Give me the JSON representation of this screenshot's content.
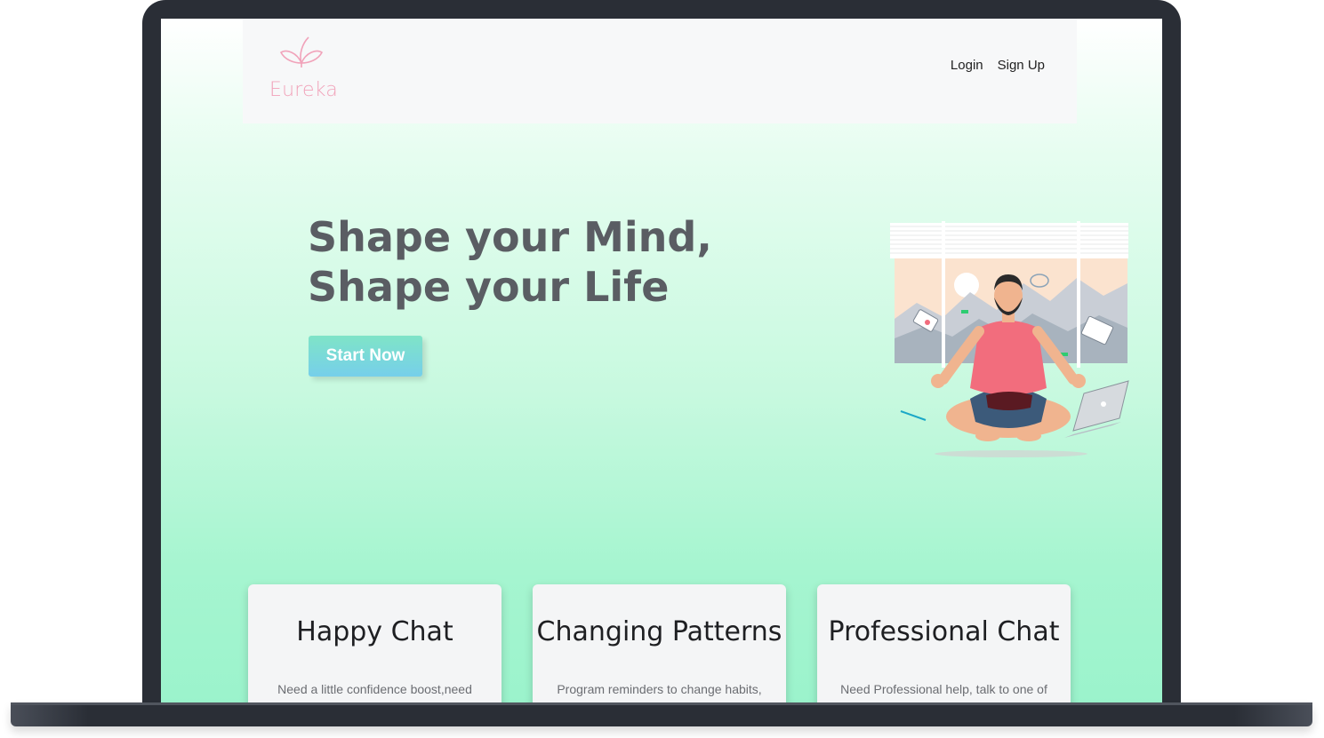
{
  "brand": {
    "name": "Eureka",
    "color": "#f1a3ba"
  },
  "nav": {
    "login": "Login",
    "signup": "Sign Up"
  },
  "hero": {
    "title_line1": "Shape your Mind,",
    "title_line2": "Shape your Life",
    "cta": "Start Now",
    "illustration": "meditating-person-illustration"
  },
  "cards": [
    {
      "title": "Happy Chat",
      "text": "Need a little confidence boost,need"
    },
    {
      "title": "Changing Patterns",
      "text": "Program reminders to change habits,"
    },
    {
      "title": "Professional Chat",
      "text": "Need Professional help, talk to one of"
    }
  ],
  "colors": {
    "frame": "#2a2e36",
    "hero_text": "#5a5d63",
    "button_gradient_start": "#7fe4c7",
    "button_gradient_end": "#76cfea",
    "background_bottom": "#9bf3cc"
  }
}
